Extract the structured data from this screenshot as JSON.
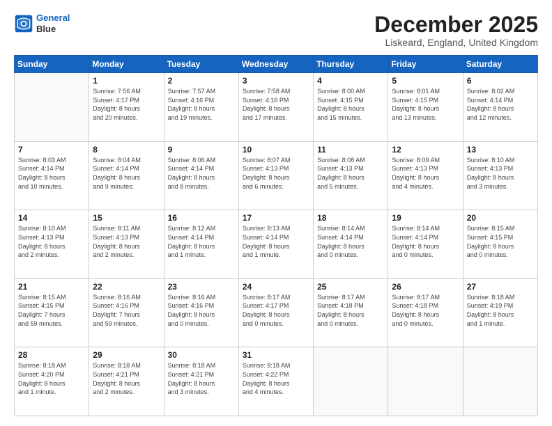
{
  "header": {
    "logo_line1": "General",
    "logo_line2": "Blue",
    "title": "December 2025",
    "subtitle": "Liskeard, England, United Kingdom"
  },
  "calendar": {
    "days_of_week": [
      "Sunday",
      "Monday",
      "Tuesday",
      "Wednesday",
      "Thursday",
      "Friday",
      "Saturday"
    ],
    "weeks": [
      [
        {
          "day": "",
          "info": ""
        },
        {
          "day": "1",
          "info": "Sunrise: 7:56 AM\nSunset: 4:17 PM\nDaylight: 8 hours\nand 20 minutes."
        },
        {
          "day": "2",
          "info": "Sunrise: 7:57 AM\nSunset: 4:16 PM\nDaylight: 8 hours\nand 19 minutes."
        },
        {
          "day": "3",
          "info": "Sunrise: 7:58 AM\nSunset: 4:16 PM\nDaylight: 8 hours\nand 17 minutes."
        },
        {
          "day": "4",
          "info": "Sunrise: 8:00 AM\nSunset: 4:15 PM\nDaylight: 8 hours\nand 15 minutes."
        },
        {
          "day": "5",
          "info": "Sunrise: 8:01 AM\nSunset: 4:15 PM\nDaylight: 8 hours\nand 13 minutes."
        },
        {
          "day": "6",
          "info": "Sunrise: 8:02 AM\nSunset: 4:14 PM\nDaylight: 8 hours\nand 12 minutes."
        }
      ],
      [
        {
          "day": "7",
          "info": "Sunrise: 8:03 AM\nSunset: 4:14 PM\nDaylight: 8 hours\nand 10 minutes."
        },
        {
          "day": "8",
          "info": "Sunrise: 8:04 AM\nSunset: 4:14 PM\nDaylight: 8 hours\nand 9 minutes."
        },
        {
          "day": "9",
          "info": "Sunrise: 8:06 AM\nSunset: 4:14 PM\nDaylight: 8 hours\nand 8 minutes."
        },
        {
          "day": "10",
          "info": "Sunrise: 8:07 AM\nSunset: 4:13 PM\nDaylight: 8 hours\nand 6 minutes."
        },
        {
          "day": "11",
          "info": "Sunrise: 8:08 AM\nSunset: 4:13 PM\nDaylight: 8 hours\nand 5 minutes."
        },
        {
          "day": "12",
          "info": "Sunrise: 8:09 AM\nSunset: 4:13 PM\nDaylight: 8 hours\nand 4 minutes."
        },
        {
          "day": "13",
          "info": "Sunrise: 8:10 AM\nSunset: 4:13 PM\nDaylight: 8 hours\nand 3 minutes."
        }
      ],
      [
        {
          "day": "14",
          "info": "Sunrise: 8:10 AM\nSunset: 4:13 PM\nDaylight: 8 hours\nand 2 minutes."
        },
        {
          "day": "15",
          "info": "Sunrise: 8:11 AM\nSunset: 4:13 PM\nDaylight: 8 hours\nand 2 minutes."
        },
        {
          "day": "16",
          "info": "Sunrise: 8:12 AM\nSunset: 4:14 PM\nDaylight: 8 hours\nand 1 minute."
        },
        {
          "day": "17",
          "info": "Sunrise: 8:13 AM\nSunset: 4:14 PM\nDaylight: 8 hours\nand 1 minute."
        },
        {
          "day": "18",
          "info": "Sunrise: 8:14 AM\nSunset: 4:14 PM\nDaylight: 8 hours\nand 0 minutes."
        },
        {
          "day": "19",
          "info": "Sunrise: 8:14 AM\nSunset: 4:14 PM\nDaylight: 8 hours\nand 0 minutes."
        },
        {
          "day": "20",
          "info": "Sunrise: 8:15 AM\nSunset: 4:15 PM\nDaylight: 8 hours\nand 0 minutes."
        }
      ],
      [
        {
          "day": "21",
          "info": "Sunrise: 8:15 AM\nSunset: 4:15 PM\nDaylight: 7 hours\nand 59 minutes."
        },
        {
          "day": "22",
          "info": "Sunrise: 8:16 AM\nSunset: 4:16 PM\nDaylight: 7 hours\nand 59 minutes."
        },
        {
          "day": "23",
          "info": "Sunrise: 8:16 AM\nSunset: 4:16 PM\nDaylight: 8 hours\nand 0 minutes."
        },
        {
          "day": "24",
          "info": "Sunrise: 8:17 AM\nSunset: 4:17 PM\nDaylight: 8 hours\nand 0 minutes."
        },
        {
          "day": "25",
          "info": "Sunrise: 8:17 AM\nSunset: 4:18 PM\nDaylight: 8 hours\nand 0 minutes."
        },
        {
          "day": "26",
          "info": "Sunrise: 8:17 AM\nSunset: 4:18 PM\nDaylight: 8 hours\nand 0 minutes."
        },
        {
          "day": "27",
          "info": "Sunrise: 8:18 AM\nSunset: 4:19 PM\nDaylight: 8 hours\nand 1 minute."
        }
      ],
      [
        {
          "day": "28",
          "info": "Sunrise: 8:18 AM\nSunset: 4:20 PM\nDaylight: 8 hours\nand 1 minute."
        },
        {
          "day": "29",
          "info": "Sunrise: 8:18 AM\nSunset: 4:21 PM\nDaylight: 8 hours\nand 2 minutes."
        },
        {
          "day": "30",
          "info": "Sunrise: 8:18 AM\nSunset: 4:21 PM\nDaylight: 8 hours\nand 3 minutes."
        },
        {
          "day": "31",
          "info": "Sunrise: 8:18 AM\nSunset: 4:22 PM\nDaylight: 8 hours\nand 4 minutes."
        },
        {
          "day": "",
          "info": ""
        },
        {
          "day": "",
          "info": ""
        },
        {
          "day": "",
          "info": ""
        }
      ]
    ]
  }
}
